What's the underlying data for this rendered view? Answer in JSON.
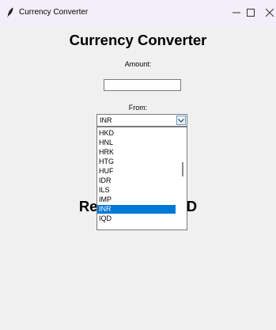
{
  "window": {
    "title": "Currency Converter",
    "minimize_symbol": "–",
    "maximize_symbol": "☐",
    "close_symbol": "✕"
  },
  "main": {
    "heading": "Currency Converter",
    "amount_label": "Amount:",
    "amount_value": "",
    "from_label": "From:",
    "from_selected": "INR",
    "result_left": "Re",
    "result_right": "SD"
  },
  "dropdown": {
    "items": [
      "HKD",
      "HNL",
      "HRK",
      "HTG",
      "HUF",
      "IDR",
      "ILS",
      "IMP",
      "INR",
      "IQD"
    ],
    "selected": "INR"
  },
  "colors": {
    "selection": "#0078d7",
    "titlebar": "#f3eef8",
    "window_bg": "#f0f0f0"
  }
}
